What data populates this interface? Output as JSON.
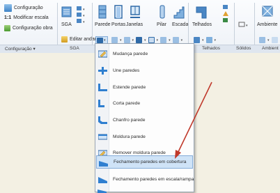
{
  "ribbon": {
    "config_group": {
      "configuracao_btn": "Configuração",
      "modificar_escala_prefix": "1:1",
      "modificar_escala_btn": "Modificar escala",
      "configuracao_obra_btn": "Configuração obra",
      "group_label": "Configuração ▾"
    },
    "sga_group": {
      "sga_btn": "SGA",
      "editar_andar_btn": "Editar andar",
      "group_label": "SGA"
    },
    "walls_group": {
      "parede_btn": "Parede",
      "portas_btn": "Portas",
      "janelas_btn": "Janelas",
      "pilar_btn": "Pilar",
      "escada_btn": "Escada"
    },
    "telhados_group": {
      "telhados_btn": "Telhados",
      "group_label": "Telhados"
    },
    "solidos_group": {
      "group_label": "Sólidos"
    },
    "ambiente_group": {
      "ambiente_btn": "Ambiente",
      "group_label": "Ambient"
    }
  },
  "menu": {
    "items": [
      {
        "label": "Mudança parede"
      },
      {
        "label": "Une paredes"
      },
      {
        "label": "Estende parede"
      },
      {
        "label": "Corta parede"
      },
      {
        "label": "Chanfro parede"
      },
      {
        "label": "Moldura parede"
      },
      {
        "label": "Remover moldura parede"
      },
      {
        "label": "Fechamento paredes em cobertura"
      },
      {
        "label": "Fechamento paredes em escala/rampa"
      }
    ],
    "highlighted_index": 7
  },
  "colors": {
    "accent_blue": "#2f7fd0",
    "highlight": "#cfe3f7",
    "arrow": "#c0392b",
    "workspace": "#f3f0e3"
  }
}
